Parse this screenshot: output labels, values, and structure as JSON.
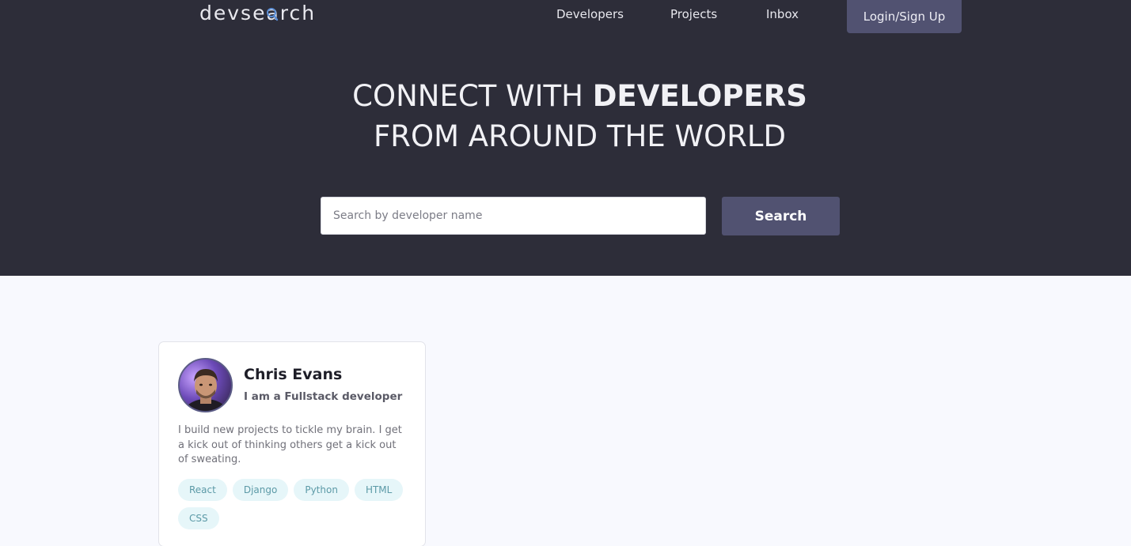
{
  "brand": {
    "logo_prefix": "devse",
    "logo_mag": "a",
    "logo_suffix": "rch"
  },
  "nav": {
    "items": [
      {
        "label": "Developers"
      },
      {
        "label": "Projects"
      },
      {
        "label": "Inbox"
      }
    ],
    "login_label": "Login/Sign Up"
  },
  "hero": {
    "line1_regular": "CONNECT WITH ",
    "line1_bold": "DEVELOPERS",
    "line2": "FROM AROUND THE WORLD"
  },
  "search": {
    "placeholder": "Search by developer name",
    "value": "",
    "button_label": "Search"
  },
  "developers": [
    {
      "name": "Chris Evans",
      "headline": "I am a Fullstack developer",
      "bio": "I build new projects to tickle my brain. I get a kick out of thinking others get a kick out of sweating.",
      "skills": [
        "React",
        "Django",
        "Python",
        "HTML",
        "CSS"
      ]
    }
  ],
  "colors": {
    "hero_bg": "#2d2d39",
    "accent": "#515271",
    "page_bg": "#f8f9fe",
    "tag_bg": "#e6f6f9",
    "tag_text": "#5c9aa7"
  }
}
